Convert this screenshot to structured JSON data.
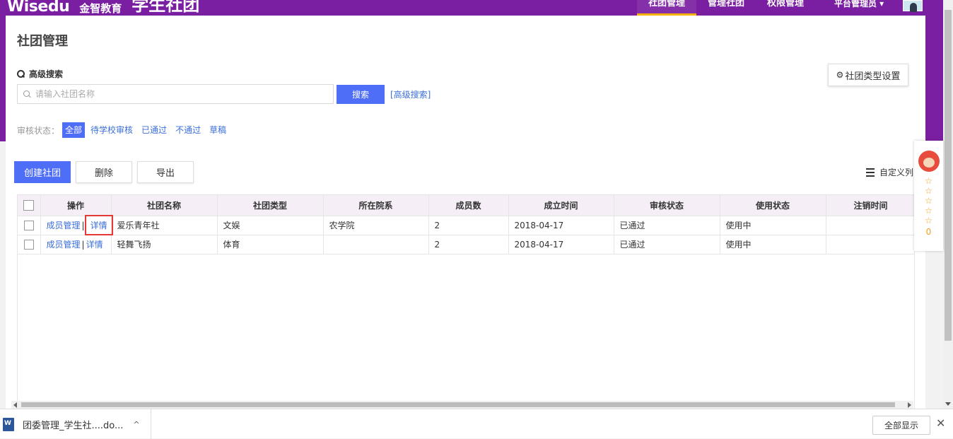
{
  "header": {
    "logo_en": "Wisedu",
    "logo_cn": "金智教育",
    "app_title": "学生社团",
    "nav": [
      "社团管理",
      "管理社团",
      "权限管理"
    ],
    "user": "平台管理员 ▾"
  },
  "page": {
    "title": "社团管理",
    "search_title": "高级搜索",
    "search_placeholder": "请输入社团名称",
    "search_button": "搜索",
    "advanced_link": "[高级搜索]",
    "type_settings": "社团类型设置"
  },
  "filter": {
    "label": "审核状态：",
    "items": [
      "全部",
      "待学校审核",
      "已通过",
      "不通过",
      "草稿"
    ],
    "active": "全部"
  },
  "actions": {
    "create": "创建社团",
    "delete": "删除",
    "export": "导出",
    "custom_columns": "自定义列"
  },
  "table": {
    "columns": [
      "操作",
      "社团名称",
      "社团类型",
      "所在院系",
      "成员数",
      "成立时间",
      "审核状态",
      "使用状态",
      "注销时间"
    ],
    "op_member": "成员管理",
    "op_sep": "|",
    "op_detail": "详情",
    "rows": [
      [
        "爱乐青年社",
        "文娱",
        "农学院",
        "2",
        "2018-04-17",
        "已通过",
        "使用中",
        ""
      ],
      [
        "轻舞飞扬",
        "体育",
        "",
        "2",
        "2018-04-17",
        "已通过",
        "使用中",
        ""
      ]
    ]
  },
  "rating": {
    "stars": [
      "☆",
      "☆",
      "☆",
      "☆",
      "☆"
    ],
    "score": "0"
  },
  "download_bar": {
    "file_name": "团委管理_学生社....do...",
    "chevron": "^",
    "show_all": "全部显示",
    "close": "✕"
  }
}
